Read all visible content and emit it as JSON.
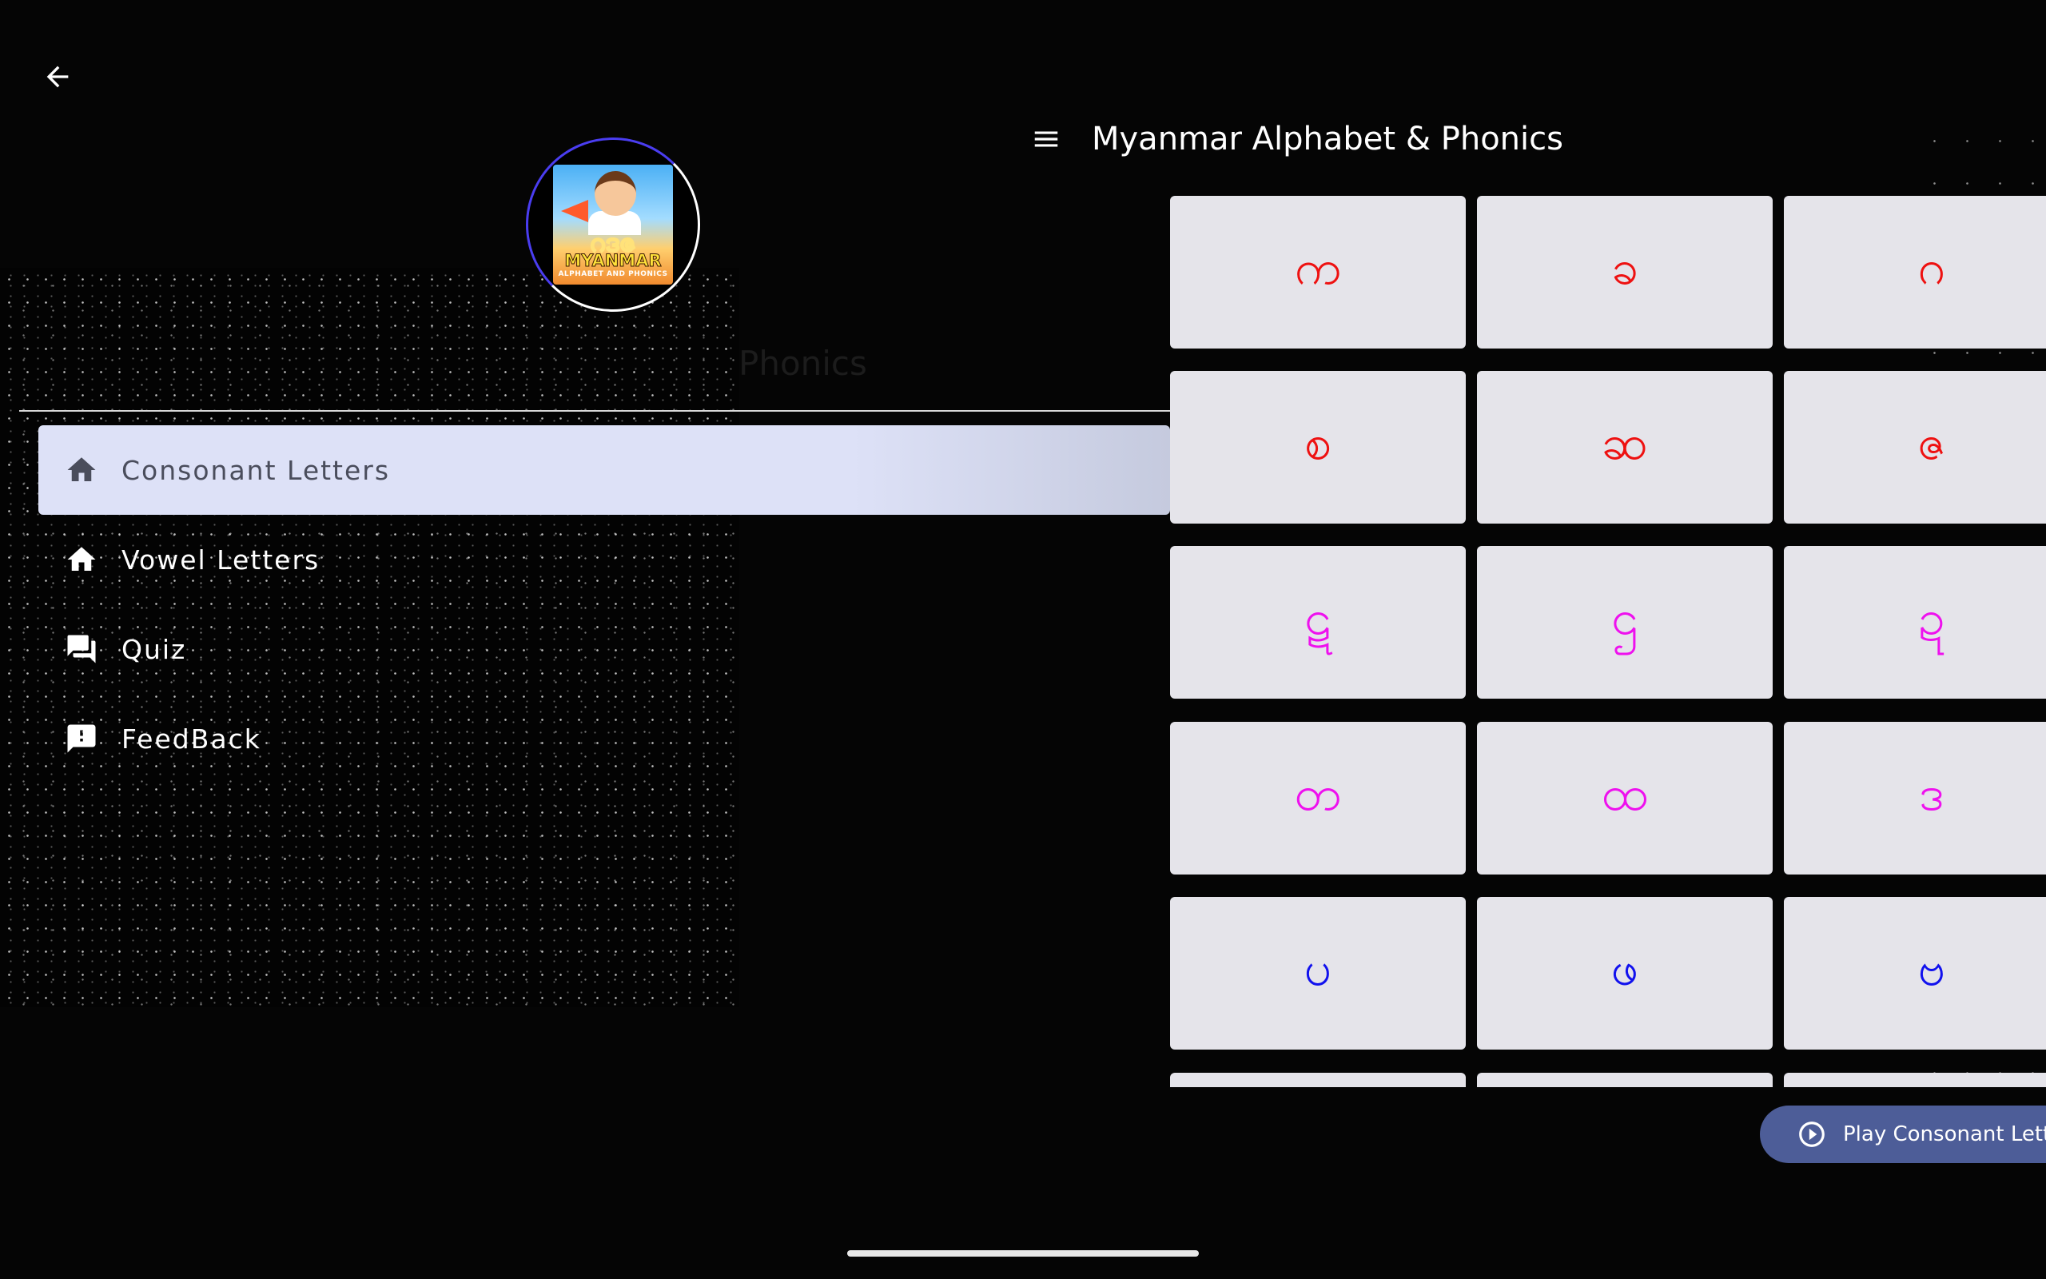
{
  "header": {
    "back_icon": "arrow-left-icon",
    "menu_icon": "hamburger-menu-icon",
    "title": "Myanmar Alphabet & Phonics"
  },
  "drawer": {
    "logo": {
      "mm_text": "ဂဒဇ",
      "title": "MYANMAR",
      "subtitle": "ALPHABET AND PHONICS"
    },
    "faded_title": "Phonics",
    "items": [
      {
        "label": "Consonant Letters",
        "icon": "home-icon",
        "active": true
      },
      {
        "label": "Vowel Letters",
        "icon": "home-icon",
        "active": false
      },
      {
        "label": "Quiz",
        "icon": "forum-icon",
        "active": false
      },
      {
        "label": "FeedBack",
        "icon": "feedback-icon",
        "active": false
      }
    ]
  },
  "grid": {
    "rows": [
      [
        {
          "char": "က",
          "color": "#ee1111"
        },
        {
          "char": "ခ",
          "color": "#ee1111"
        },
        {
          "char": "ဂ",
          "color": "#ee1111"
        }
      ],
      [
        {
          "char": "စ",
          "color": "#ee1111"
        },
        {
          "char": "ဆ",
          "color": "#ee1111"
        },
        {
          "char": "ဇ",
          "color": "#ee1111"
        }
      ],
      [
        {
          "char": "ဋ",
          "color": "#ee11ee"
        },
        {
          "char": "ဌ",
          "color": "#ee11ee"
        },
        {
          "char": "ဍ",
          "color": "#ee11ee"
        }
      ],
      [
        {
          "char": "တ",
          "color": "#ee11ee"
        },
        {
          "char": "ထ",
          "color": "#ee11ee"
        },
        {
          "char": "ဒ",
          "color": "#ee11ee"
        }
      ],
      [
        {
          "char": "ပ",
          "color": "#1111ee"
        },
        {
          "char": "ဖ",
          "color": "#1111ee"
        },
        {
          "char": "ဗ",
          "color": "#1111ee"
        }
      ],
      [
        {
          "char": "",
          "color": "#1111ee"
        },
        {
          "char": "",
          "color": "#1111ee"
        },
        {
          "char": "",
          "color": "#1111ee"
        }
      ]
    ]
  },
  "play_button": {
    "label": "Play Consonant Letters",
    "icon": "play-circle-icon"
  },
  "colors": {
    "accent": "#4d5d98",
    "active_item_bg": "#dde1f7",
    "tile_bg": "#e5e4ea"
  }
}
